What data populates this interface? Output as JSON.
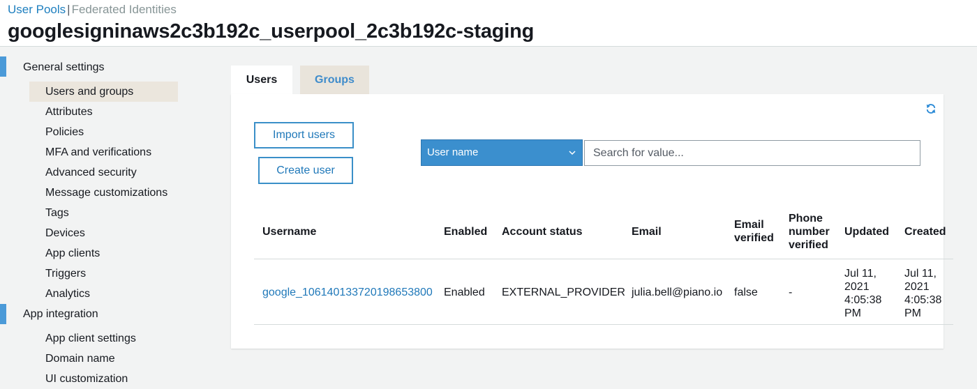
{
  "breadcrumb": {
    "active": "User Pools",
    "separator": "|",
    "inactive": "Federated Identities"
  },
  "page_title": "googlesigninaws2c3b192c_userpool_2c3b192c-staging",
  "sidebar": {
    "general_settings": {
      "heading": "General settings",
      "items": [
        "Users and groups",
        "Attributes",
        "Policies",
        "MFA and verifications",
        "Advanced security",
        "Message customizations",
        "Tags",
        "Devices",
        "App clients",
        "Triggers",
        "Analytics"
      ],
      "selected": "Users and groups"
    },
    "app_integration": {
      "heading": "App integration",
      "items": [
        "App client settings",
        "Domain name",
        "UI customization"
      ]
    }
  },
  "tabs": {
    "users": "Users",
    "groups": "Groups",
    "active": "Users"
  },
  "toolbar": {
    "import_users": "Import users",
    "create_user": "Create user",
    "filter_attribute": "User name",
    "search_placeholder": "Search for value...",
    "refresh_icon": "refresh-icon"
  },
  "table": {
    "columns": [
      "Username",
      "Enabled",
      "Account status",
      "Email",
      "Email verified",
      "Phone number verified",
      "Updated",
      "Created"
    ],
    "rows": [
      {
        "username": "google_106140133720198653800",
        "enabled": "Enabled",
        "account_status": "EXTERNAL_PROVIDER",
        "email": "julia.bell@piano.io",
        "email_verified": "false",
        "phone_number_verified": "-",
        "updated": "Jul 11, 2021 4:05:38 PM",
        "created": "Jul 11, 2021 4:05:38 PM"
      }
    ]
  },
  "colors": {
    "accent": "#1e7fbf",
    "select_bg": "#3b8fce",
    "section_marker": "#4b9ad8",
    "selected_nav_bg": "#ebe6dd"
  }
}
